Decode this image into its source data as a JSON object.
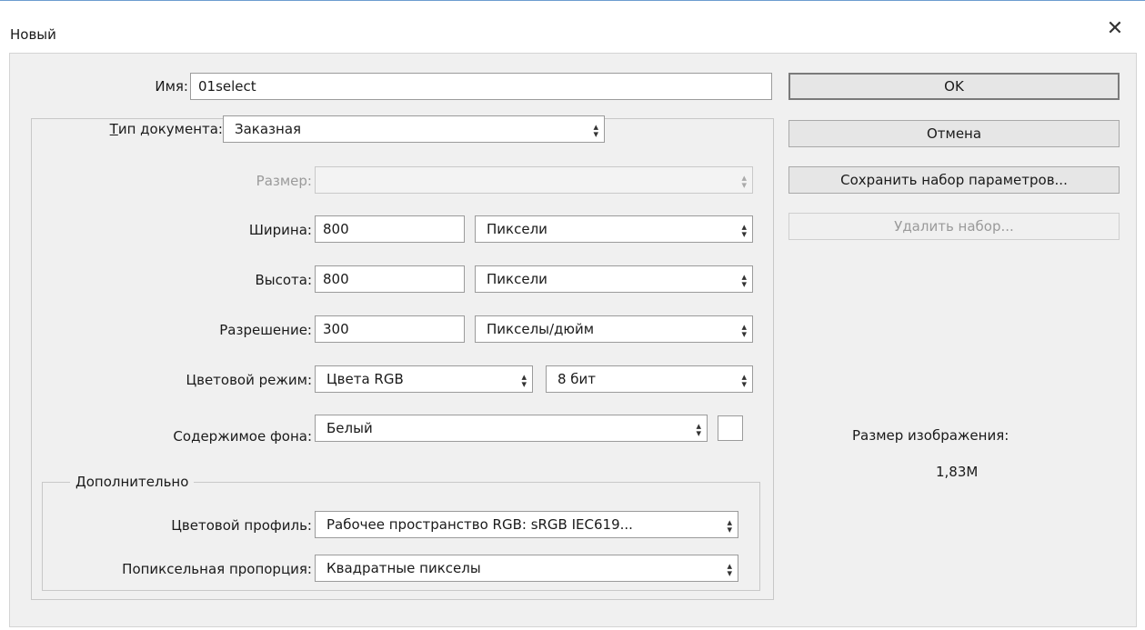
{
  "window": {
    "title": "Новый",
    "close_glyph": "✕"
  },
  "name": {
    "label": "Имя:",
    "value": "01select"
  },
  "doc_type": {
    "label": "Тип документа:",
    "value": "Заказная"
  },
  "size": {
    "label": "Размер:",
    "value": ""
  },
  "width": {
    "label": "Ширина:",
    "value": "800",
    "unit": "Пиксели"
  },
  "height": {
    "label": "Высота:",
    "value": "800",
    "unit": "Пиксели"
  },
  "resolution": {
    "label": "Разрешение:",
    "value": "300",
    "unit": "Пикселы/дюйм"
  },
  "color_mode": {
    "label": "Цветовой режим:",
    "value": "Цвета RGB",
    "depth": "8 бит"
  },
  "background": {
    "label": "Содержимое фона:",
    "value": "Белый",
    "swatch_color": "#ffffff"
  },
  "advanced": {
    "legend": "Дополнительно",
    "profile_label": "Цветовой профиль:",
    "profile_value": "Рабочее пространство RGB:  sRGB IEC619...",
    "aspect_label": "Попиксельная пропорция:",
    "aspect_value": "Квадратные пикселы"
  },
  "buttons": {
    "ok": "OK",
    "cancel": "Отмена",
    "save_preset": "Сохранить набор параметров...",
    "delete_preset": "Удалить набор..."
  },
  "image_size": {
    "label": "Размер изображения:",
    "value": "1,83M"
  }
}
